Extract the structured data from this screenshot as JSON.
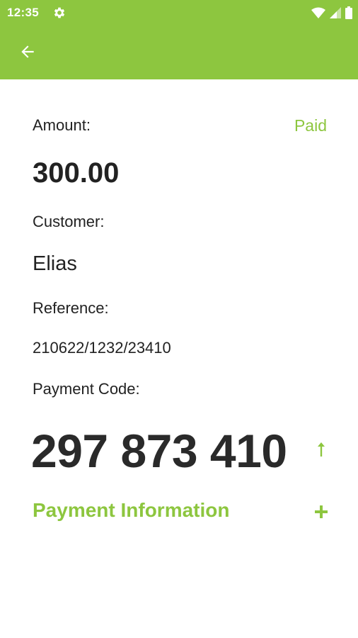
{
  "status_bar": {
    "time": "12:35",
    "icons": [
      "gear-icon",
      "wifi-icon",
      "cellular-signal-icon",
      "battery-icon"
    ]
  },
  "app_bar": {
    "back_icon": "arrow-left-icon"
  },
  "details": {
    "amount_label": "Amount:",
    "status": "Paid",
    "amount_value": "300.00",
    "customer_label": "Customer:",
    "customer_value": "Elias",
    "reference_label": "Reference:",
    "reference_value": "210622/1232/23410",
    "payment_code_label": "Payment Code:",
    "payment_code_value": "297 873 410"
  },
  "payment_information": {
    "title": "Payment Information",
    "expand_icon": "plus-icon"
  },
  "colors": {
    "brand_green": "#8dc63f",
    "text_dark": "#222222",
    "background": "#ffffff"
  }
}
